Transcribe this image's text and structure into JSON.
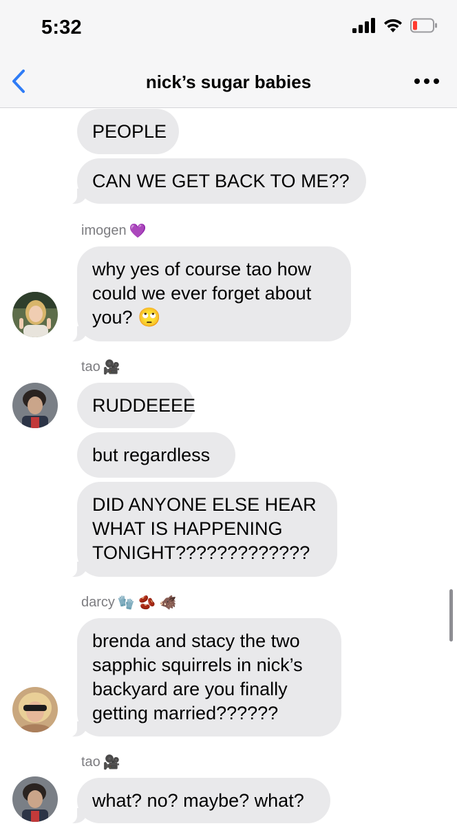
{
  "status_bar": {
    "time": "5:32",
    "icons": [
      "cellular-signal-icon",
      "wifi-icon",
      "battery-low-icon"
    ],
    "battery_color": "#ff3b30"
  },
  "nav": {
    "title": "nick’s sugar babies",
    "back_icon": "chevron-left-icon",
    "more_icon": "more-icon",
    "accent": "#2f7cf6"
  },
  "messages": [
    {
      "text": "PEOPLE"
    },
    {
      "text": "CAN WE GET BACK TO ME??"
    },
    {
      "sender": "imogen",
      "sender_emoji": "💜",
      "text": "why yes of course tao how\ncould we ever forget about\nyou? 🙄"
    },
    {
      "sender": "tao",
      "sender_emoji": "🎥",
      "text": "RUDDEEEE"
    },
    {
      "text": "but regardless"
    },
    {
      "text": "DID ANYONE ELSE HEAR\nWHAT IS HAPPENING\nTONIGHT?????????????"
    },
    {
      "sender": "darcy",
      "sender_emoji": "🧤 🫘 🐗",
      "text": "brenda and stacy the two\nsapphic squirrels in nick’s\nbackyard are you finally\ngetting married??????"
    },
    {
      "sender": "tao",
      "sender_emoji": "🎥",
      "text": "what? no? maybe? what?"
    }
  ]
}
